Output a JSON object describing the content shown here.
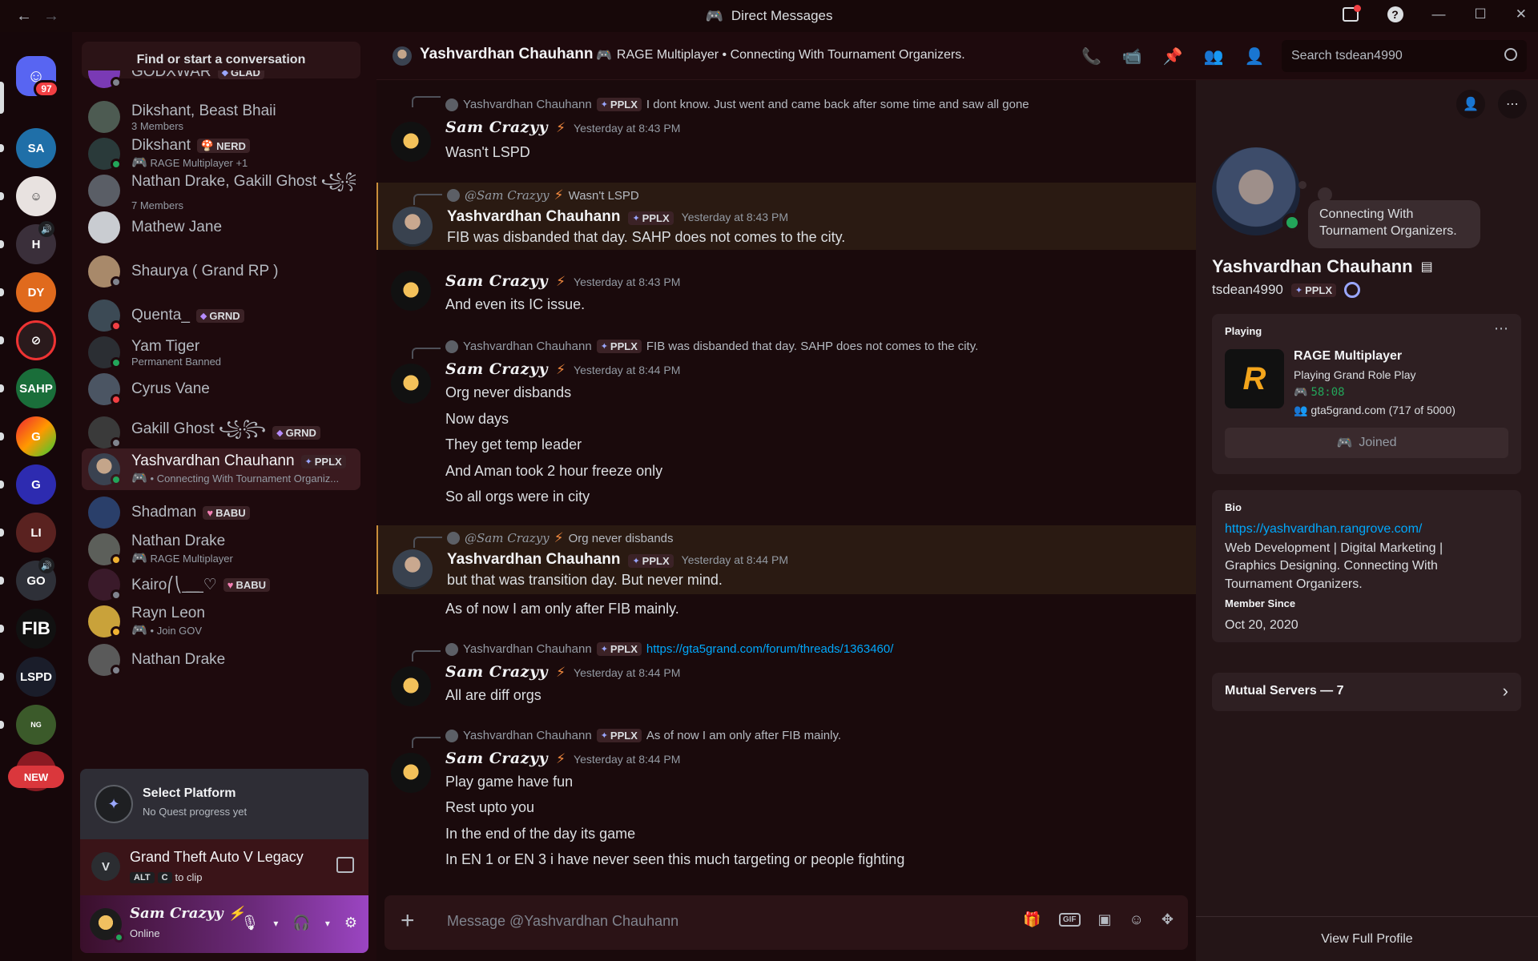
{
  "window": {
    "title": "Direct Messages"
  },
  "rail": {
    "home_badge": "97",
    "new_label": "NEW",
    "servers": [
      "SAHP",
      "FIB",
      "LSPD",
      "GO"
    ]
  },
  "dm_list": {
    "search_placeholder": "Find or start a conversation",
    "items": [
      {
        "name": "GODXWAR",
        "tag": "GLAD",
        "sub": ""
      },
      {
        "name": "Dikshant, Beast Bhaii",
        "tag": "",
        "sub": "3 Members"
      },
      {
        "name": "Dikshant",
        "tag": "NERD",
        "sub": "RAGE Multiplayer +1"
      },
      {
        "name": "Nathan Drake, Gakill Ghost ꧁꧂...",
        "tag": "",
        "sub": "7 Members"
      },
      {
        "name": "Mathew Jane",
        "tag": "",
        "sub": ""
      },
      {
        "name": "Shaurya ( Grand RP )",
        "tag": "",
        "sub": ""
      },
      {
        "name": "Quenta_",
        "tag": "GRND",
        "sub": ""
      },
      {
        "name": "Yam Tiger",
        "tag": "",
        "sub": "Permanent Banned"
      },
      {
        "name": "Cyrus Vane",
        "tag": "",
        "sub": ""
      },
      {
        "name": "Gakill Ghost ꧁꧂",
        "tag": "GRND",
        "sub": ""
      },
      {
        "name": "Yashvardhan Chauhann",
        "tag": "PPLX",
        "sub": "• Connecting With Tournament Organiz..."
      },
      {
        "name": "Shadman",
        "tag": "BABU",
        "sub": ""
      },
      {
        "name": "Nathan Drake",
        "tag": "",
        "sub": "RAGE Multiplayer"
      },
      {
        "name": "Kairo⎛⎝ ̲ ̲ ̲ ̲ ♡",
        "tag": "BABU",
        "sub": ""
      },
      {
        "name": "Rayn Leon",
        "tag": "",
        "sub": "• Join GOV"
      },
      {
        "name": "Nathan Drake",
        "tag": "",
        "sub": ""
      }
    ]
  },
  "quest": {
    "title": "Select Platform",
    "subtitle": "No Quest progress yet"
  },
  "activity": {
    "game": "Grand Theft Auto V Legacy",
    "key1": "ALT",
    "key2": "C",
    "hint": "to clip"
  },
  "user": {
    "name": "Sam Crazyy",
    "status": "Online"
  },
  "header": {
    "name": "Yashvardhan Chauhann",
    "activity": "RAGE Multiplayer • Connecting With Tournament Organizers.",
    "search_placeholder": "Search tsdean4990"
  },
  "messages": [
    {
      "reply_name": "Yashvardhan Chauhann",
      "reply_tag": "PPLX",
      "reply_text": "I dont know. Just went and came back after some time and saw all gone",
      "author": "Sam Crazyy",
      "time": "Yesterday at 8:43 PM",
      "lines": [
        "Wasn't LSPD"
      ]
    },
    {
      "reply_name": "@Sam Crazyy",
      "reply_tag": "",
      "reply_text": "Wasn't LSPD",
      "author": "Yashvardhan Chauhann",
      "author_tag": "PPLX",
      "time": "Yesterday at 8:43 PM",
      "lines": [
        "FIB was disbanded that day. SAHP does not comes to the city."
      ]
    },
    {
      "author": "Sam Crazyy",
      "time": "Yesterday at 8:43 PM",
      "lines": [
        "And even its IC issue."
      ]
    },
    {
      "reply_name": "Yashvardhan Chauhann",
      "reply_tag": "PPLX",
      "reply_text": "FIB was disbanded that day. SAHP does not comes to the city.",
      "author": "Sam Crazyy",
      "time": "Yesterday at 8:44 PM",
      "lines": [
        "Org never disbands",
        "Now days",
        "They get temp leader",
        "And Aman took 2 hour freeze only",
        "So all orgs were in city"
      ]
    },
    {
      "reply_name": "@Sam Crazyy",
      "reply_tag": "",
      "reply_text": "Org never disbands",
      "author": "Yashvardhan Chauhann",
      "author_tag": "PPLX",
      "time": "Yesterday at 8:44 PM",
      "lines": [
        "but that was transition day. But never mind.",
        "As of now I am only after FIB mainly."
      ]
    },
    {
      "reply_name": "Yashvardhan Chauhann",
      "reply_tag": "PPLX",
      "reply_link": "https://gta5grand.com/forum/threads/1363460/",
      "author": "Sam Crazyy",
      "time": "Yesterday at 8:44 PM",
      "lines": [
        "All are diff orgs"
      ]
    },
    {
      "reply_name": "Yashvardhan Chauhann",
      "reply_tag": "PPLX",
      "reply_text": "As of now I am only after FIB mainly.",
      "author": "Sam Crazyy",
      "time": "Yesterday at 8:44 PM",
      "lines": [
        "Play game have fun",
        "Rest upto you",
        "In the end of the day its game",
        "In EN 1 or EN 3 i have never seen this much targeting or people fighting"
      ]
    }
  ],
  "composer": {
    "placeholder": "Message @Yashvardhan Chauhann",
    "gif_label": "GIF"
  },
  "profile": {
    "status_bubble": "Connecting With Tournament Organizers.",
    "name": "Yashvardhan Chauhann",
    "username": "tsdean4990",
    "tag": "PPLX",
    "playing_label": "Playing",
    "game_name": "RAGE Multiplayer",
    "game_detail": "Playing Grand Role Play",
    "game_time": "58:08",
    "game_server": "gta5grand.com (717 of 5000)",
    "join_label": "Joined",
    "bio_label": "Bio",
    "bio_link": "https://yashvardhan.rangrove.com/",
    "bio_text": "Web Development | Digital Marketing | Graphics Designing. Connecting With Tournament Organizers.",
    "member_since_label": "Member Since",
    "member_since": "Oct 20, 2020",
    "mutual_servers": "Mutual Servers — 7",
    "view_full": "View Full Profile"
  },
  "colors": {
    "accent": "#5865f2",
    "online": "#23a55a",
    "dnd": "#f23f43",
    "link": "#00a8fc",
    "highlight_border": "#c98e3a"
  }
}
